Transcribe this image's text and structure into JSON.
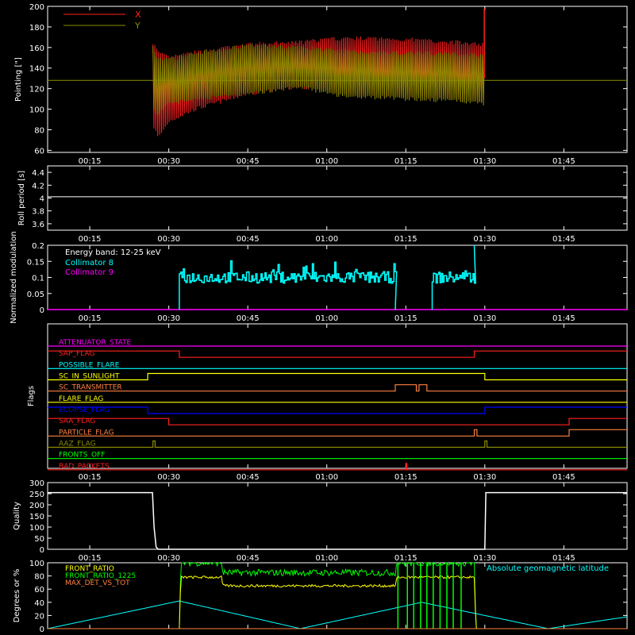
{
  "time_axis": {
    "ticks": [
      "00:15",
      "00:30",
      "00:45",
      "01:00",
      "01:15",
      "01:30",
      "01:45"
    ],
    "tick_minutes": [
      15,
      30,
      45,
      60,
      75,
      90,
      105
    ],
    "range_minutes": [
      7,
      117
    ]
  },
  "colors": {
    "background": "#000000",
    "axes": "#ffffff",
    "red": "#ff2020",
    "olive": "#8c8c00",
    "cyan": "#00ffff",
    "magenta": "#ff00ff",
    "yellow": "#ffff00",
    "green": "#00ff00",
    "orange": "#ff8040",
    "blue": "#0000ff"
  },
  "chart_data": [
    {
      "panel": "pointing",
      "type": "line",
      "ylabel": "Pointing [\"]",
      "ylim": [
        58,
        200
      ],
      "yticks": [
        60,
        80,
        100,
        120,
        140,
        160,
        180,
        200
      ],
      "legend_placement": "top-left",
      "series": [
        {
          "name": "X",
          "color": "red",
          "envelope": {
            "x": [
              27,
              28,
              30,
              35,
              45,
              55,
              60,
              65,
              75,
              85,
              90
            ],
            "max": [
              165,
              155,
              150,
              155,
              163,
              165,
              168,
              169,
              168,
              165,
              163
            ],
            "min": [
              85,
              72,
              88,
              100,
              115,
              122,
              118,
              114,
              113,
              110,
              108
            ]
          }
        },
        {
          "name": "Y",
          "color": "olive",
          "envelope": {
            "x": [
              27,
              28,
              30,
              35,
              45,
              55,
              60,
              65,
              75,
              85,
              90
            ],
            "max": [
              160,
              150,
              148,
              155,
              162,
              160,
              158,
              156,
              155,
              154,
              152
            ],
            "min": [
              100,
              95,
              105,
              110,
              115,
              122,
              115,
              112,
              110,
              108,
              105
            ]
          }
        }
      ],
      "reference_line": {
        "y": 128,
        "color": "olive"
      }
    },
    {
      "panel": "roll_period",
      "type": "line",
      "ylabel": "Roll period [s]",
      "ylim": [
        3.5,
        4.5
      ],
      "yticks": [
        3.6,
        3.8,
        4.0,
        4.2,
        4.4
      ],
      "series": [
        {
          "color": "axes",
          "x": [
            7,
            117
          ],
          "y": [
            4.02,
            4.02
          ]
        }
      ]
    },
    {
      "panel": "modulation",
      "type": "line",
      "ylabel": "Normalized modulation",
      "ylim": [
        0,
        0.2
      ],
      "yticks": [
        0.0,
        0.05,
        0.1,
        0.15,
        0.2
      ],
      "annotation": "Energy band: 12-25 keV",
      "series": [
        {
          "name": "Collimator 8",
          "color": "cyan",
          "segments": [
            [
              32,
              73
            ],
            [
              80,
              88
            ]
          ],
          "level": 0.1,
          "noise": 0.018,
          "spikes": [
            0.2,
            0.0
          ]
        },
        {
          "name": "Collimator 9",
          "color": "magenta",
          "x": [
            7,
            117
          ],
          "y": [
            0.0,
            0.0
          ]
        }
      ]
    },
    {
      "panel": "flags",
      "type": "step",
      "ylabel": "Flags",
      "series": [
        {
          "name": "ATTENUATOR_STATE",
          "color": "magenta",
          "steps": [
            [
              7,
              0
            ],
            [
              117,
              0
            ]
          ]
        },
        {
          "name": "SAP_FLAG",
          "color": "red",
          "steps": [
            [
              7,
              1
            ],
            [
              32,
              0
            ],
            [
              88,
              1
            ],
            [
              117,
              1
            ]
          ]
        },
        {
          "name": "POSSIBLE_FLARE",
          "color": "cyan",
          "steps": [
            [
              7,
              0
            ],
            [
              117,
              0
            ]
          ]
        },
        {
          "name": "SC_IN_SUNLIGHT",
          "color": "yellow",
          "steps": [
            [
              7,
              0
            ],
            [
              26,
              1
            ],
            [
              90,
              0
            ],
            [
              117,
              0
            ]
          ]
        },
        {
          "name": "SC_TRANSMITTER",
          "color": "orange",
          "steps": [
            [
              7,
              0
            ],
            [
              73,
              1
            ],
            [
              77,
              0
            ],
            [
              77.5,
              1
            ],
            [
              79,
              0
            ],
            [
              117,
              0
            ]
          ]
        },
        {
          "name": "FLARE_FLAG",
          "color": "yellow",
          "steps": [
            [
              7,
              0
            ],
            [
              117,
              0
            ]
          ]
        },
        {
          "name": "ECLIPSE_FLAG",
          "color": "blue",
          "steps": [
            [
              7,
              1
            ],
            [
              26,
              0
            ],
            [
              90,
              1
            ],
            [
              117,
              1
            ]
          ]
        },
        {
          "name": "SAA_FLAG",
          "color": "red",
          "steps": [
            [
              7,
              1
            ],
            [
              30,
              0
            ],
            [
              106,
              1
            ],
            [
              117,
              1
            ]
          ]
        },
        {
          "name": "PARTICLE_FLAG",
          "color": "orange",
          "steps": [
            [
              7,
              0
            ],
            [
              88,
              1
            ],
            [
              88.5,
              0
            ],
            [
              106,
              1
            ],
            [
              117,
              1
            ]
          ]
        },
        {
          "name": "AAZ_FLAG",
          "color": "olive",
          "steps": [
            [
              7,
              0
            ],
            [
              27,
              1
            ],
            [
              27.4,
              0
            ],
            [
              90,
              1
            ],
            [
              90.4,
              0
            ],
            [
              117,
              0
            ]
          ]
        },
        {
          "name": "FRONTS_OFF",
          "color": "green",
          "steps": [
            [
              7,
              0
            ],
            [
              117,
              0
            ]
          ]
        },
        {
          "name": "BAD_PACKETS",
          "color": "red",
          "steps": [
            [
              7,
              0
            ],
            [
              75,
              1
            ],
            [
              75.2,
              0
            ],
            [
              117,
              0
            ]
          ]
        }
      ]
    },
    {
      "panel": "quality",
      "type": "line",
      "ylabel": "Quality",
      "ylim": [
        0,
        300
      ],
      "yticks": [
        0,
        50,
        100,
        150,
        200,
        250,
        300
      ],
      "series": [
        {
          "color": "axes",
          "x": [
            7,
            26.9,
            27.2,
            27.6,
            28,
            90,
            90.2,
            117
          ],
          "y": [
            255,
            255,
            100,
            10,
            0,
            0,
            255,
            255
          ]
        }
      ]
    },
    {
      "panel": "degrees",
      "type": "line",
      "ylabel": "Degrees or %",
      "ylim": [
        0,
        100
      ],
      "yticks": [
        0,
        20,
        40,
        60,
        80,
        100
      ],
      "legend_placement": "top-left",
      "series": [
        {
          "name": "FRONT_RATIO",
          "color": "yellow",
          "x": [
            7,
            32,
            32.3,
            40,
            40.3,
            73,
            73.3,
            88,
            88.3,
            117
          ],
          "y": [
            0,
            0,
            78,
            78,
            65,
            65,
            78,
            78,
            0,
            0
          ]
        },
        {
          "name": "FRONT_RATIO_1225",
          "color": "green",
          "x": [
            7,
            32,
            32.3,
            40,
            40.3,
            73,
            73.3,
            88,
            88.3,
            117
          ],
          "y": [
            0,
            0,
            100,
            100,
            85,
            85,
            100,
            100,
            0,
            0
          ]
        },
        {
          "name": "MAX_DET_VS_TOT",
          "color": "orange",
          "x": [
            7,
            117
          ],
          "y": [
            0,
            0
          ]
        },
        {
          "name": "Absolute geomagnetic latitude",
          "color": "cyan",
          "x": [
            7,
            32,
            55,
            78,
            102,
            117
          ],
          "y": [
            0,
            42,
            0,
            40,
            0,
            18
          ]
        }
      ]
    }
  ]
}
